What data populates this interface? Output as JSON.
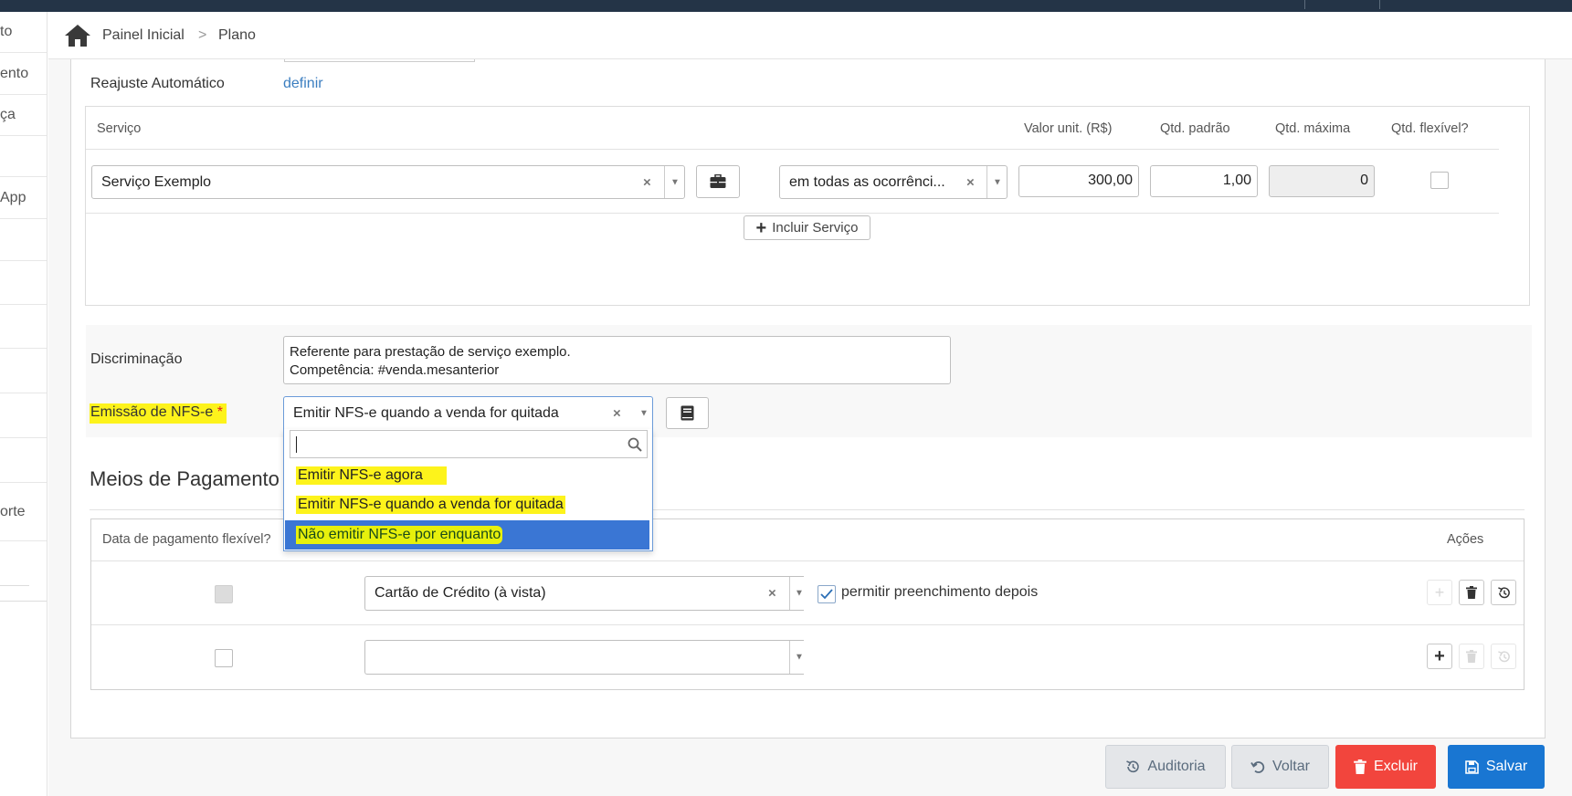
{
  "sidebar": {
    "items": [
      {
        "label": "to"
      },
      {
        "label": "ento"
      },
      {
        "label": "ça"
      },
      {
        "label": ""
      },
      {
        "label": "App"
      },
      {
        "label": ""
      },
      {
        "label": ""
      },
      {
        "label": ""
      },
      {
        "label": ""
      },
      {
        "label": ""
      },
      {
        "label": ""
      },
      {
        "label": "orte"
      }
    ]
  },
  "breadcrumb": {
    "home": "Painel Inicial",
    "separator": ">",
    "current": "Plano"
  },
  "form": {
    "reajuste_label": "Reajuste Automático",
    "reajuste_link": "definir",
    "discriminacao_label": "Discriminação",
    "discriminacao_lines": [
      "Referente para prestação de serviço exemplo.",
      "Competência: #venda.mesanterior"
    ],
    "emissao_label": "Emissão de NFS-e",
    "required_mark": "*",
    "emissao_value": "Emitir NFS-e quando a venda for quitada"
  },
  "servicos": {
    "headers": {
      "servico": "Serviço",
      "valor": "Valor unit. (R$)",
      "qtd_padrao": "Qtd. padrão",
      "qtd_maxima": "Qtd. máxima",
      "qtd_flexivel": "Qtd. flexível?"
    },
    "row": {
      "servico": "Serviço Exemplo",
      "ocorrencia": "em todas as ocorrênci...",
      "valor": "300,00",
      "qtd_padrao": "1,00",
      "qtd_maxima": "0",
      "qtd_flexivel": false
    },
    "add_label": "Incluir Serviço"
  },
  "dropdown": {
    "search_value": "",
    "options": [
      {
        "label": "Emitir NFS-e agora",
        "highlighted": false
      },
      {
        "label": "Emitir NFS-e quando a venda for quitada",
        "highlighted": false
      },
      {
        "label": "Não emitir NFS-e por enquanto",
        "highlighted": true
      }
    ]
  },
  "pagamento": {
    "title": "Meios de Pagamento",
    "headers": {
      "data_flexivel": "Data de pagamento flexível?",
      "acoes": "Ações"
    },
    "rows": [
      {
        "flexivel": false,
        "meio": "Cartão de Crédito (à vista)",
        "permitir_checked": true,
        "permitir_label": "permitir preenchimento depois"
      },
      {
        "flexivel": false,
        "meio": "",
        "permitir_checked": false,
        "permitir_label": ""
      }
    ]
  },
  "footer": {
    "auditoria": "Auditoria",
    "voltar": "Voltar",
    "excluir": "Excluir",
    "salvar": "Salvar"
  },
  "colors": {
    "topbar": "#243447",
    "link": "#3b7ec0",
    "highlight": "#fdf31b",
    "selected_option": "#3a76d4",
    "danger": "#f2453d",
    "primary": "#1976d2"
  }
}
